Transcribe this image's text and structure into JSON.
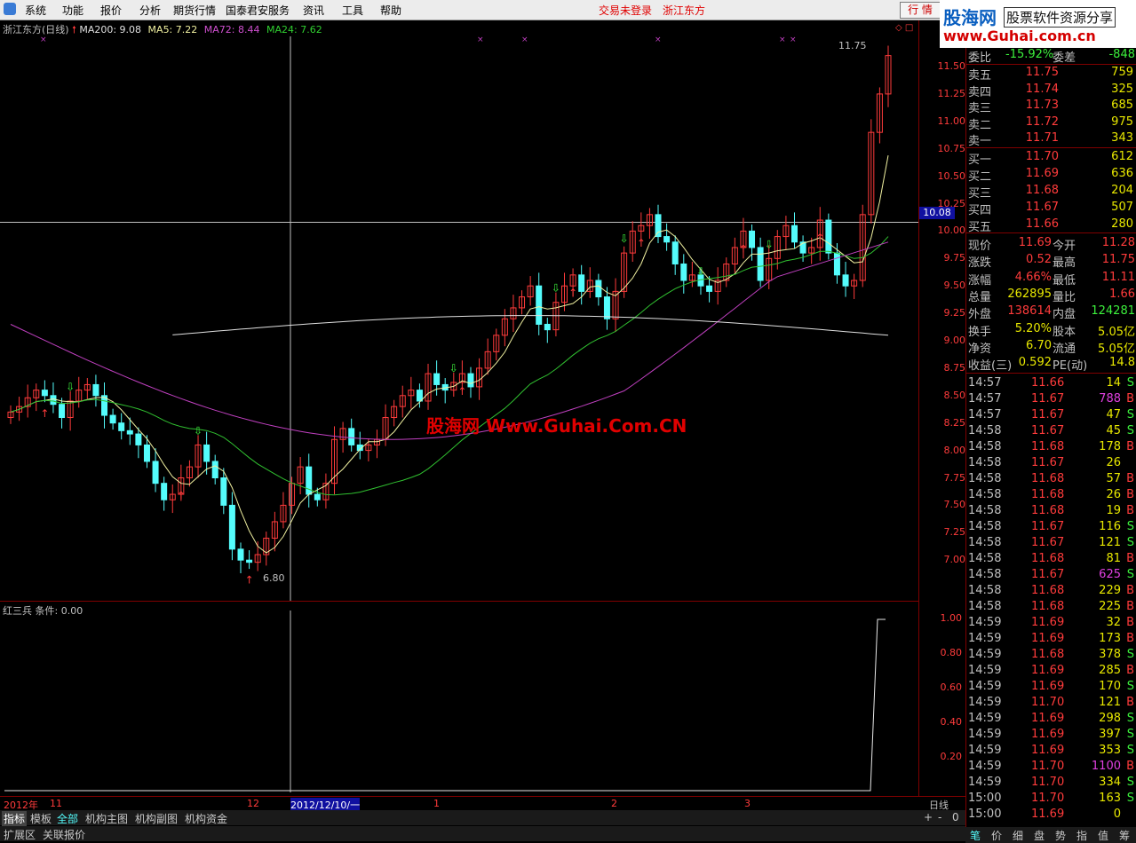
{
  "menu": [
    "系统",
    "功能",
    "报价",
    "分析",
    "期货行情",
    "国泰君安服务",
    "资讯",
    "工具",
    "帮助"
  ],
  "trade_status": "交易未登录",
  "stock_name": "浙江东方",
  "quote_button": "行 情",
  "logo": {
    "name": "股海网",
    "slogan": "股票软件资源分享",
    "url": "www.Guhai.com.cn"
  },
  "legend": {
    "title": "浙江东方(日线)",
    "ma200": "MA200: 9.08",
    "ma5": "MA5: 7.22",
    "ma72": "MA72: 8.44",
    "ma24": "MA24: 7.62"
  },
  "watermark": "股海网 Www.Guhai.Com.CN",
  "cursor_price": "10.08",
  "high_label": "11.75",
  "low_label": "6.80",
  "indicator_legend": "红三兵  条件: 0.00",
  "price_ticks": [
    "11.50",
    "11.25",
    "11.00",
    "10.75",
    "10.50",
    "10.25",
    "10.00",
    "9.75",
    "9.50",
    "9.25",
    "9.00",
    "8.75",
    "8.50",
    "8.25",
    "8.00",
    "7.75",
    "7.50",
    "7.25",
    "7.00"
  ],
  "indicator_ticks": [
    "1.00",
    "0.80",
    "0.60",
    "0.40",
    "0.20"
  ],
  "x_labels": [
    "2012年",
    "11",
    "12",
    "2012/12/10/一",
    "1",
    "2",
    "3"
  ],
  "period_label": "日线",
  "tabs": [
    "指标",
    "模板",
    "全部",
    "机构主图",
    "机构副图",
    "机构资金"
  ],
  "tabs2": [
    "扩展区",
    "关联报价"
  ],
  "zoom_controls": [
    "+",
    "-",
    "0"
  ],
  "order_ratio": {
    "label1": "委比",
    "val1": "-15.92%",
    "label2": "委差",
    "val2": "-848"
  },
  "asks": [
    {
      "label": "卖五",
      "price": "11.75",
      "vol": "759"
    },
    {
      "label": "卖四",
      "price": "11.74",
      "vol": "325"
    },
    {
      "label": "卖三",
      "price": "11.73",
      "vol": "685"
    },
    {
      "label": "卖二",
      "price": "11.72",
      "vol": "975"
    },
    {
      "label": "卖一",
      "price": "11.71",
      "vol": "343"
    }
  ],
  "bids": [
    {
      "label": "买一",
      "price": "11.70",
      "vol": "612"
    },
    {
      "label": "买二",
      "price": "11.69",
      "vol": "636"
    },
    {
      "label": "买三",
      "price": "11.68",
      "vol": "204"
    },
    {
      "label": "买四",
      "price": "11.67",
      "vol": "507"
    },
    {
      "label": "买五",
      "price": "11.66",
      "vol": "280"
    }
  ],
  "stats": [
    {
      "l1": "现价",
      "v1": "11.69",
      "c1": "#ff3b3b",
      "l2": "今开",
      "v2": "11.28",
      "c2": "#ff3b3b"
    },
    {
      "l1": "涨跌",
      "v1": "0.52",
      "c1": "#ff3b3b",
      "l2": "最高",
      "v2": "11.75",
      "c2": "#ff3b3b"
    },
    {
      "l1": "涨幅",
      "v1": "4.66%",
      "c1": "#ff3b3b",
      "l2": "最低",
      "v2": "11.11",
      "c2": "#ff3b3b"
    },
    {
      "l1": "总量",
      "v1": "262895",
      "c1": "#e8e800",
      "l2": "量比",
      "v2": "1.66",
      "c2": "#ff3b3b"
    },
    {
      "l1": "外盘",
      "v1": "138614",
      "c1": "#ff3b3b",
      "l2": "内盘",
      "v2": "124281",
      "c2": "#3cf03c"
    },
    {
      "l1": "换手",
      "v1": "5.20%",
      "c1": "#e8e800",
      "l2": "股本",
      "v2": "5.05亿",
      "c2": "#e8e800"
    },
    {
      "l1": "净资",
      "v1": "6.70",
      "c1": "#e8e800",
      "l2": "流通",
      "v2": "5.05亿",
      "c2": "#e8e800"
    },
    {
      "l1": "收益(三)",
      "v1": "0.592",
      "c1": "#e8e800",
      "l2": "PE(动)",
      "v2": "14.8",
      "c2": "#e8e800"
    }
  ],
  "ticks": [
    {
      "t": "14:57",
      "p": "11.66",
      "v": "14",
      "bs": "S"
    },
    {
      "t": "14:57",
      "p": "11.67",
      "v": "788",
      "bs": "B"
    },
    {
      "t": "14:57",
      "p": "11.67",
      "v": "47",
      "bs": "S"
    },
    {
      "t": "14:58",
      "p": "11.67",
      "v": "45",
      "bs": "S"
    },
    {
      "t": "14:58",
      "p": "11.68",
      "v": "178",
      "bs": "B"
    },
    {
      "t": "14:58",
      "p": "11.67",
      "v": "26",
      "bs": ""
    },
    {
      "t": "14:58",
      "p": "11.68",
      "v": "57",
      "bs": "B"
    },
    {
      "t": "14:58",
      "p": "11.68",
      "v": "26",
      "bs": "B"
    },
    {
      "t": "14:58",
      "p": "11.68",
      "v": "19",
      "bs": "B"
    },
    {
      "t": "14:58",
      "p": "11.67",
      "v": "116",
      "bs": "S"
    },
    {
      "t": "14:58",
      "p": "11.67",
      "v": "121",
      "bs": "S"
    },
    {
      "t": "14:58",
      "p": "11.68",
      "v": "81",
      "bs": "B"
    },
    {
      "t": "14:58",
      "p": "11.67",
      "v": "625",
      "bs": "S"
    },
    {
      "t": "14:58",
      "p": "11.68",
      "v": "229",
      "bs": "B"
    },
    {
      "t": "14:58",
      "p": "11.68",
      "v": "225",
      "bs": "B"
    },
    {
      "t": "14:59",
      "p": "11.69",
      "v": "32",
      "bs": "B"
    },
    {
      "t": "14:59",
      "p": "11.69",
      "v": "173",
      "bs": "B"
    },
    {
      "t": "14:59",
      "p": "11.68",
      "v": "378",
      "bs": "S"
    },
    {
      "t": "14:59",
      "p": "11.69",
      "v": "285",
      "bs": "B"
    },
    {
      "t": "14:59",
      "p": "11.69",
      "v": "170",
      "bs": "S"
    },
    {
      "t": "14:59",
      "p": "11.70",
      "v": "121",
      "bs": "B"
    },
    {
      "t": "14:59",
      "p": "11.69",
      "v": "298",
      "bs": "S"
    },
    {
      "t": "14:59",
      "p": "11.69",
      "v": "397",
      "bs": "S"
    },
    {
      "t": "14:59",
      "p": "11.69",
      "v": "353",
      "bs": "S"
    },
    {
      "t": "14:59",
      "p": "11.70",
      "v": "1100",
      "bs": "B"
    },
    {
      "t": "14:59",
      "p": "11.70",
      "v": "334",
      "bs": "S"
    },
    {
      "t": "15:00",
      "p": "11.70",
      "v": "163",
      "bs": "S"
    },
    {
      "t": "15:00",
      "p": "11.69",
      "v": "0",
      "bs": ""
    }
  ],
  "bottom_tabs": [
    "笔",
    "价",
    "细",
    "盘",
    "势",
    "指",
    "值",
    "筹"
  ],
  "colors": {
    "up": "#ff3b3b",
    "down": "#54fcfc",
    "ma5": "#f0f0a0",
    "ma24": "#30c030",
    "ma72": "#c040c0",
    "ma200": "#e0e0e0",
    "grid": "#800000"
  }
}
